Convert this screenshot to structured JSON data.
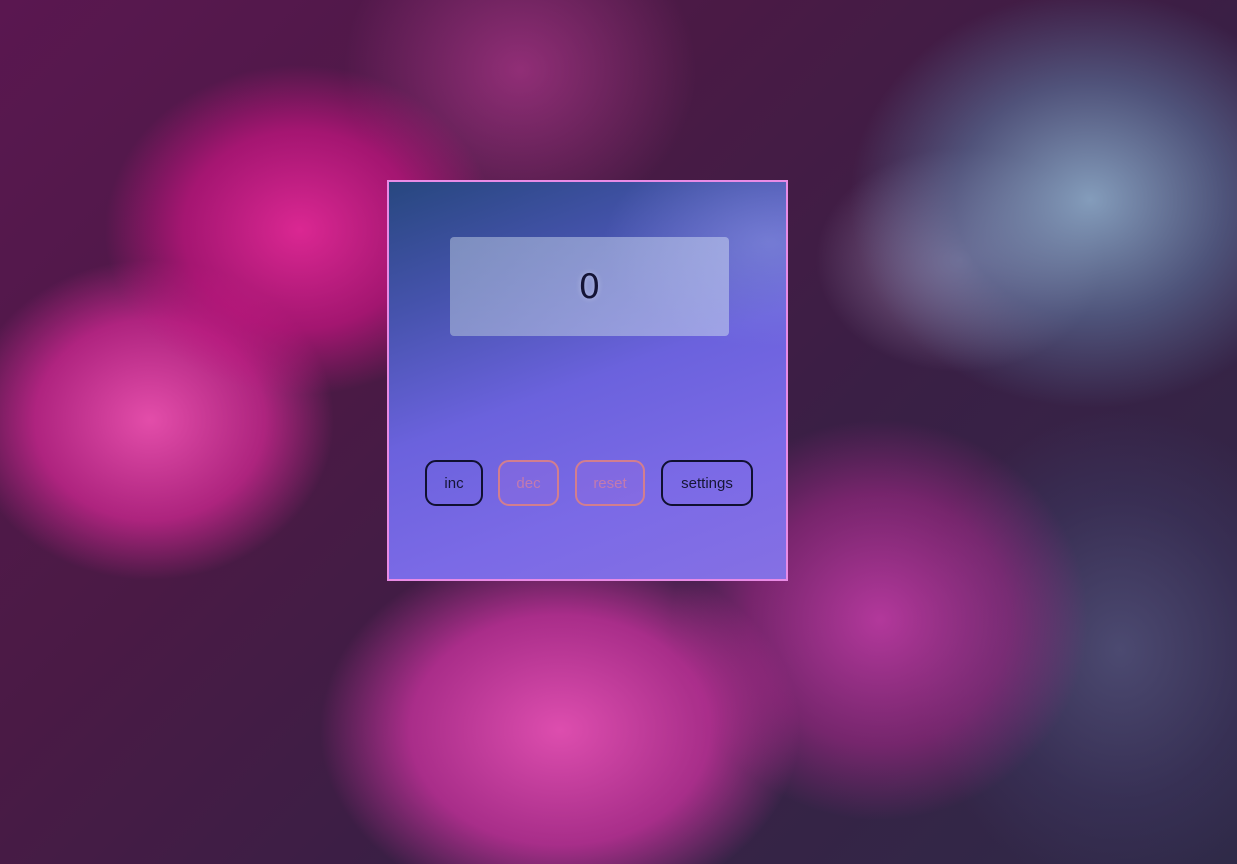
{
  "counter": {
    "value": "0"
  },
  "buttons": {
    "inc_label": "inc",
    "dec_label": "dec",
    "reset_label": "reset",
    "settings_label": "settings"
  },
  "colors": {
    "card_border": "#e98be6",
    "active_button_border": "#101030",
    "disabled_button_border": "#d27e8e"
  }
}
